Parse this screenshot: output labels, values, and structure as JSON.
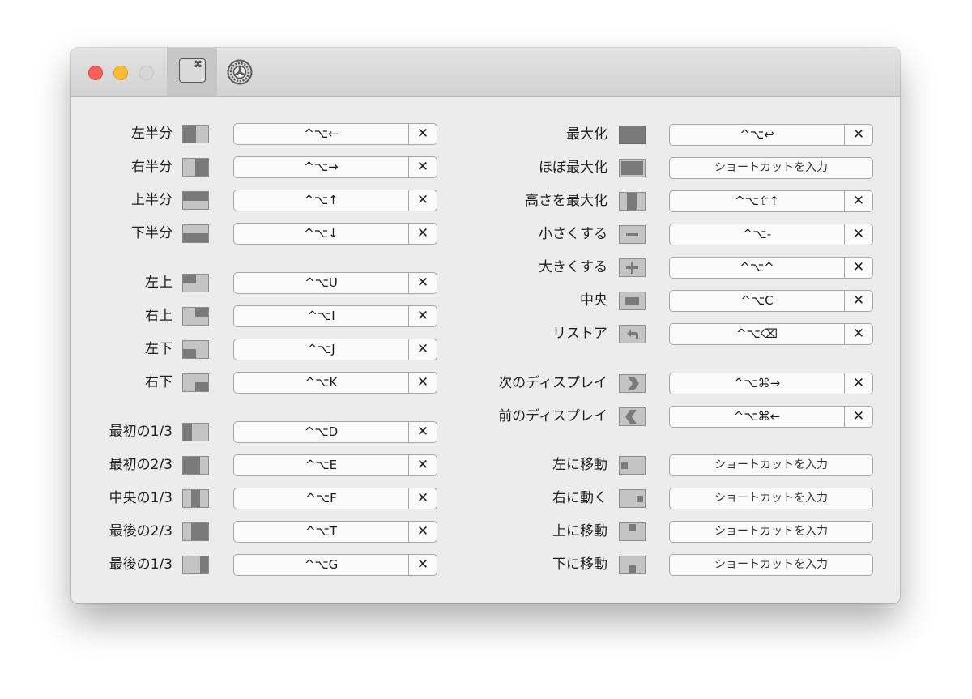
{
  "toolbar": {
    "keyboard_tab_symbol": "⌘"
  },
  "left": [
    {
      "label": "左半分",
      "shortcut": "^⌥←",
      "icon": "left-half"
    },
    {
      "label": "右半分",
      "shortcut": "^⌥→",
      "icon": "right-half"
    },
    {
      "label": "上半分",
      "shortcut": "^⌥↑",
      "icon": "top-half"
    },
    {
      "label": "下半分",
      "shortcut": "^⌥↓",
      "icon": "bottom-half"
    },
    {
      "label": "左上",
      "shortcut": "^⌥U",
      "icon": "top-left"
    },
    {
      "label": "右上",
      "shortcut": "^⌥I",
      "icon": "top-right"
    },
    {
      "label": "左下",
      "shortcut": "^⌥J",
      "icon": "bottom-left"
    },
    {
      "label": "右下",
      "shortcut": "^⌥K",
      "icon": "bottom-right"
    },
    {
      "label": "最初の1/3",
      "shortcut": "^⌥D",
      "icon": "first-third"
    },
    {
      "label": "最初の2/3",
      "shortcut": "^⌥E",
      "icon": "first-two-thirds"
    },
    {
      "label": "中央の1/3",
      "shortcut": "^⌥F",
      "icon": "center-third"
    },
    {
      "label": "最後の2/3",
      "shortcut": "^⌥T",
      "icon": "last-two-thirds"
    },
    {
      "label": "最後の1/3",
      "shortcut": "^⌥G",
      "icon": "last-third"
    }
  ],
  "right": [
    {
      "label": "最大化",
      "shortcut": "^⌥↩",
      "icon": "maximize"
    },
    {
      "label": "ほぼ最大化",
      "shortcut": "",
      "placeholder": "ショートカットを入力",
      "icon": "almost-maximize"
    },
    {
      "label": "高さを最大化",
      "shortcut": "^⌥⇧↑",
      "icon": "maximize-height"
    },
    {
      "label": "小さくする",
      "shortcut": "^⌥-",
      "icon": "smaller"
    },
    {
      "label": "大きくする",
      "shortcut": "^⌥^",
      "icon": "larger"
    },
    {
      "label": "中央",
      "shortcut": "^⌥C",
      "icon": "center"
    },
    {
      "label": "リストア",
      "shortcut": "^⌥⌫",
      "icon": "restore"
    },
    {
      "label": "次のディスプレイ",
      "shortcut": "^⌥⌘→",
      "icon": "next-display"
    },
    {
      "label": "前のディスプレイ",
      "shortcut": "^⌥⌘←",
      "icon": "previous-display"
    },
    {
      "label": "左に移動",
      "shortcut": "",
      "placeholder": "ショートカットを入力",
      "icon": "move-left"
    },
    {
      "label": "右に動く",
      "shortcut": "",
      "placeholder": "ショートカットを入力",
      "icon": "move-right"
    },
    {
      "label": "上に移動",
      "shortcut": "",
      "placeholder": "ショートカットを入力",
      "icon": "move-up"
    },
    {
      "label": "下に移動",
      "shortcut": "",
      "placeholder": "ショートカットを入力",
      "icon": "move-down"
    }
  ],
  "clear_symbol": "✕",
  "colors": {
    "icon_fill": "#7a7a7a",
    "icon_bg": "#c4c4c4",
    "field_border": "#a6a6a6"
  }
}
